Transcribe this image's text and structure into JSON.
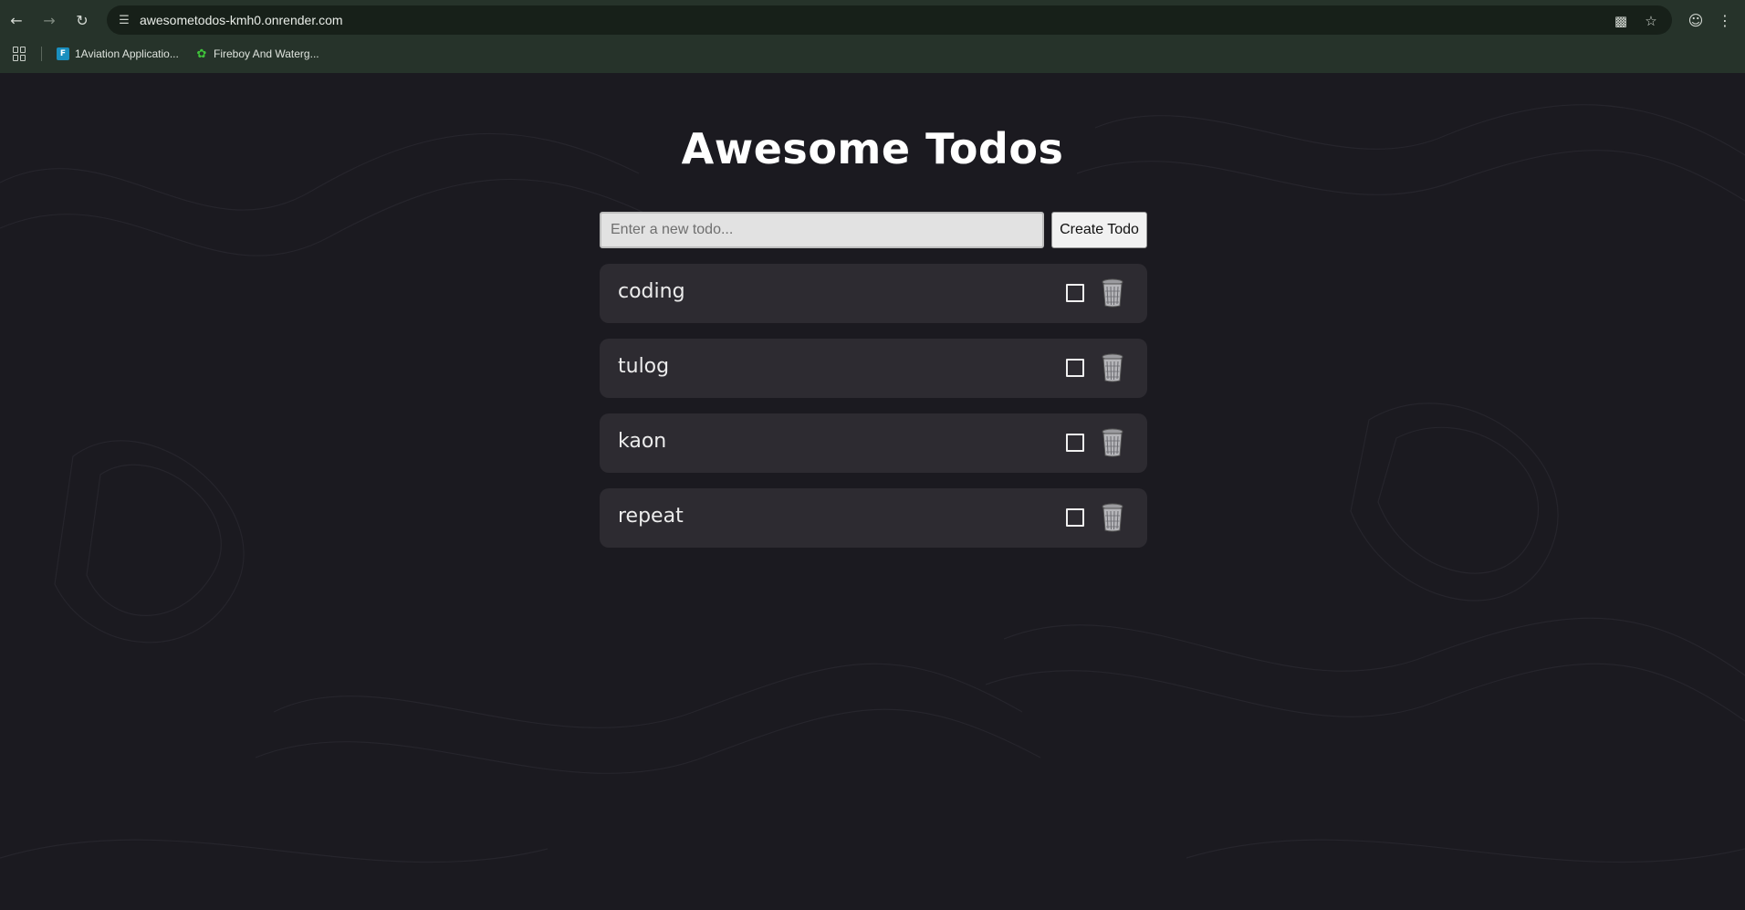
{
  "browser": {
    "url": "awesometodos-kmh0.onrender.com",
    "bookmarks": [
      {
        "label": "1Aviation Applicatio...",
        "icon": "aviation-favicon"
      },
      {
        "label": "Fireboy And Waterg...",
        "icon": "game-favicon"
      }
    ]
  },
  "app": {
    "title": "Awesome Todos",
    "input_placeholder": "Enter a new todo...",
    "input_value": "",
    "create_button_label": "Create Todo"
  },
  "todos": [
    {
      "text": "coding",
      "completed": false
    },
    {
      "text": "tulog",
      "completed": false
    },
    {
      "text": "kaon",
      "completed": false
    },
    {
      "text": "repeat",
      "completed": false
    }
  ],
  "colors": {
    "background": "#1b1a20",
    "card": "#2d2b31",
    "chrome": "#26332a"
  }
}
